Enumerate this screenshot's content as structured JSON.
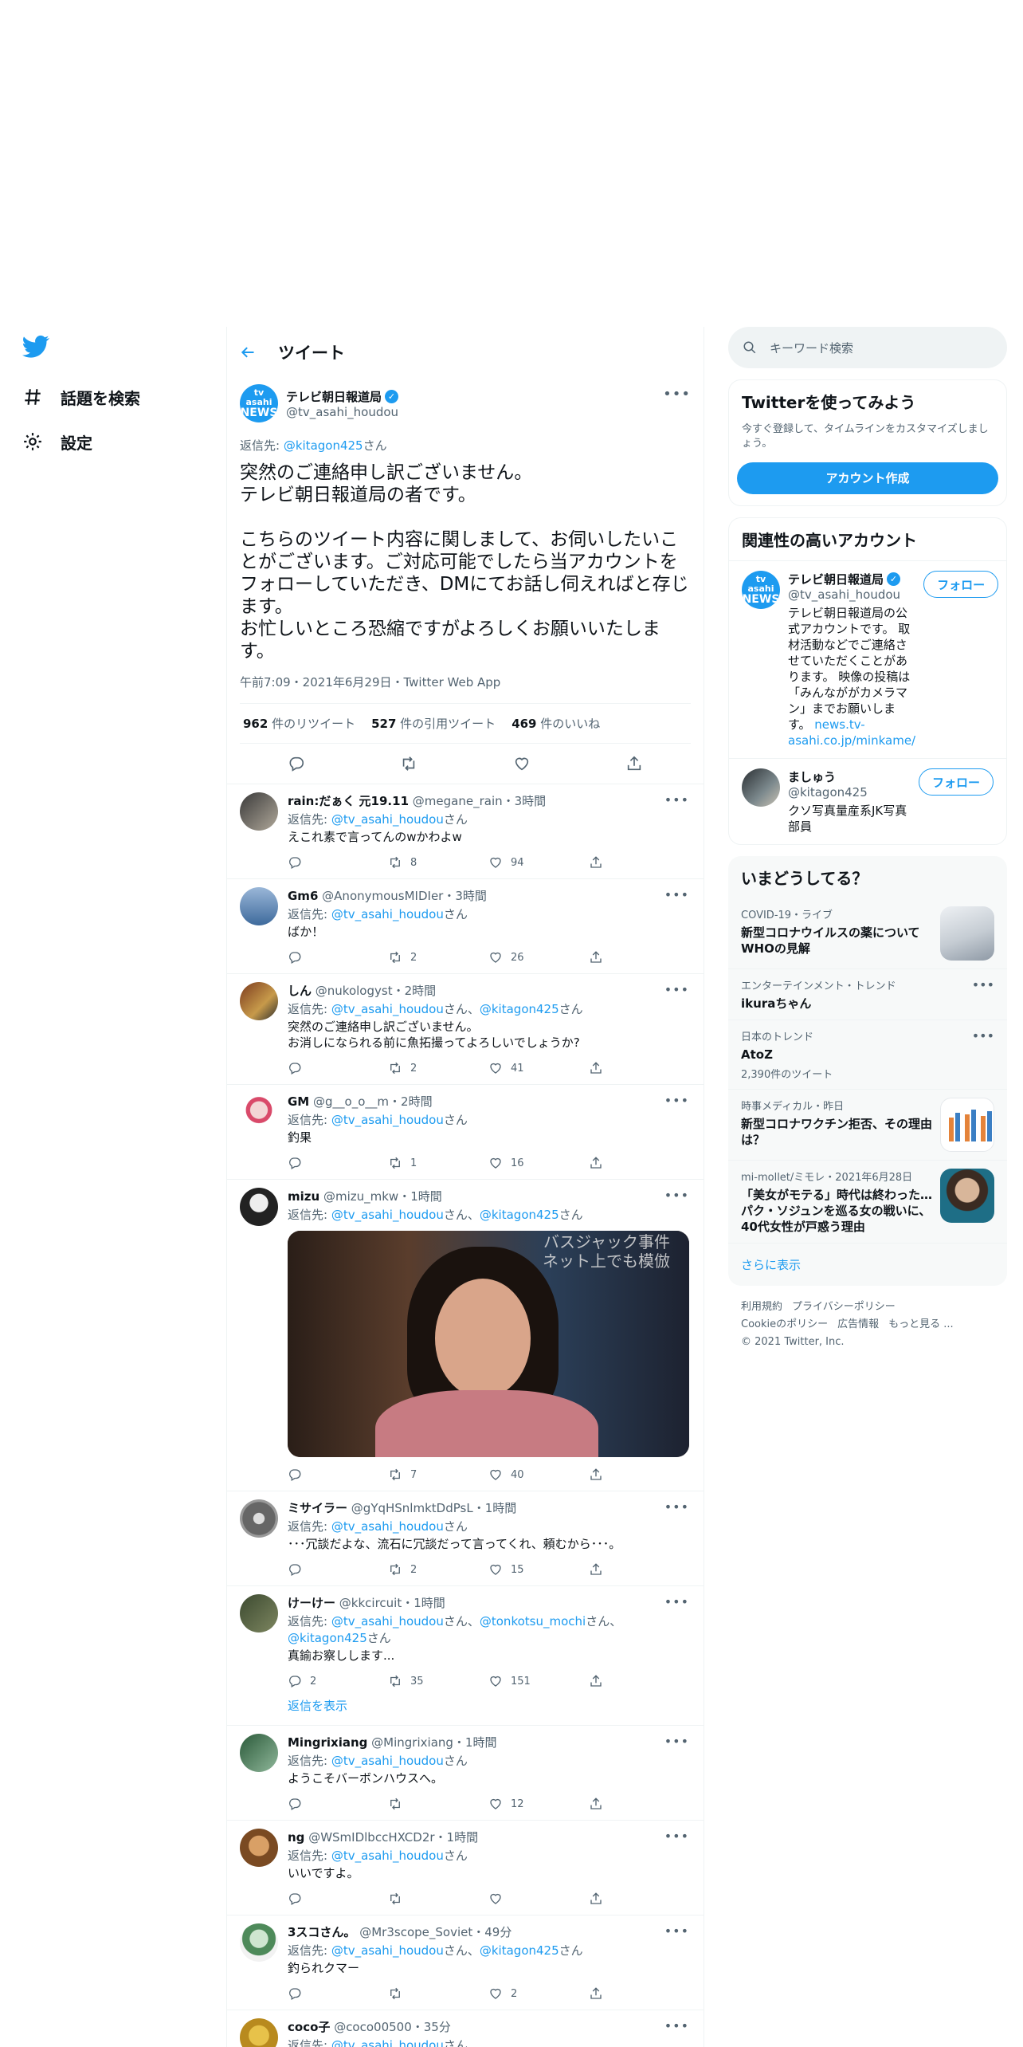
{
  "nav": {
    "items": [
      {
        "label": "話題を検索",
        "icon": "hashtag-icon"
      },
      {
        "label": "設定",
        "icon": "gear-icon"
      }
    ]
  },
  "header": {
    "title": "ツイート"
  },
  "main_tweet": {
    "name": "テレビ朝日報道局",
    "handle": "@tv_asahi_houdou",
    "avatar_text_1": "tv asahi",
    "avatar_text_2": "NEWS",
    "reply_prefix": "返信先: ",
    "reply_to": "@kitagon425",
    "reply_suffix": "さん",
    "text": "突然のご連絡申し訳ございません。\nテレビ朝日報道局の者です。\n\nこちらのツイート内容に関しまして、お伺いしたいことがございます。ご対応可能でしたら当アカウントをフォローしていただき、DMにてお話し伺えればと存じます。\nお忙しいところ恐縮ですがよろしくお願いいたします。",
    "meta": "午前7:09・2021年6月29日・Twitter Web App",
    "retweets": "962",
    "retweets_label": " 件のリツイート",
    "quotes": "527",
    "quotes_label": " 件の引用ツイート",
    "likes": "469",
    "likes_label": " 件のいいね"
  },
  "replies": [
    {
      "name": "rain:だぁく 元19.11",
      "handle": "@megane_rain",
      "time": "・3時間",
      "reply_to": "@tv_asahi_houdou",
      "reply_suffix": "さん",
      "text": "えこれ素で言ってんのwかわよw",
      "replies_count": "",
      "retweets_count": "8",
      "likes_count": "94"
    },
    {
      "name": "Gm6",
      "handle": "@AnonymousMIDIer",
      "time": "・3時間",
      "reply_to": "@tv_asahi_houdou",
      "reply_suffix": "さん",
      "text": "ばか！",
      "replies_count": "",
      "retweets_count": "2",
      "likes_count": "26"
    },
    {
      "name": "しん",
      "handle": "@nukologyst",
      "time": "・2時間",
      "reply_to": "@tv_asahi_houdou",
      "reply_mid": "さん、",
      "reply_to_2": "@kitagon425",
      "reply_suffix": "さん",
      "text": "突然のご連絡申し訳ございません。\nお消しになられる前に魚拓撮ってよろしいでしょうか?",
      "replies_count": "",
      "retweets_count": "2",
      "likes_count": "41"
    },
    {
      "name": "GM",
      "handle": "@g__o_o__m",
      "time": "・2時間",
      "reply_to": "@tv_asahi_houdou",
      "reply_suffix": "さん",
      "text": "釣果",
      "replies_count": "",
      "retweets_count": "1",
      "likes_count": "16"
    },
    {
      "name": "mizu",
      "handle": "@mizu_mkw",
      "time": "・1時間",
      "reply_to": "@tv_asahi_houdou",
      "reply_mid": "さん、",
      "reply_to_2": "@kitagon425",
      "reply_suffix": "さん",
      "text": "",
      "media_caption_1": "バスジャック事件",
      "media_caption_2": "ネット上でも模倣",
      "replies_count": "",
      "retweets_count": "7",
      "likes_count": "40"
    },
    {
      "name": "ミサイラー",
      "handle": "@gYqHSnlmktDdPsL",
      "time": "・1時間",
      "reply_to": "@tv_asahi_houdou",
      "reply_suffix": "さん",
      "text": "･･･冗談だよな、流石に冗談だって言ってくれ、頼むから･･･。",
      "replies_count": "",
      "retweets_count": "2",
      "likes_count": "15"
    },
    {
      "name": "けーけー",
      "handle": "@kkcircuit",
      "time": "・1時間",
      "reply_to": "@tv_asahi_houdou",
      "reply_mid": "さん、",
      "reply_to_2": "@tonkotsu_mochi",
      "reply_mid_2": "さん、",
      "reply_to_3": "@kitagon425",
      "reply_suffix": "さん",
      "text": "真鍮お察しします...",
      "replies_count": "2",
      "retweets_count": "35",
      "likes_count": "151",
      "show_replies": "返信を表示"
    },
    {
      "name": "Mingrixiang",
      "handle": "@Mingrixiang",
      "time": "・1時間",
      "reply_to": "@tv_asahi_houdou",
      "reply_suffix": "さん",
      "text": "ようこそバーボンハウスへ。",
      "replies_count": "",
      "retweets_count": "",
      "likes_count": "12"
    },
    {
      "name": "ng",
      "handle": "@WSmIDlbccHXCD2r",
      "time": "・1時間",
      "reply_to": "@tv_asahi_houdou",
      "reply_suffix": "さん",
      "text": "いいですよ。",
      "replies_count": "",
      "retweets_count": "",
      "likes_count": ""
    },
    {
      "name": "3スコさん。",
      "handle": "@Mr3scope_Soviet",
      "time": "・49分",
      "reply_to": "@tv_asahi_houdou",
      "reply_mid": "さん、",
      "reply_to_2": "@kitagon425",
      "reply_suffix": "さん",
      "text": "釣られクマー",
      "replies_count": "",
      "retweets_count": "",
      "likes_count": "2"
    },
    {
      "name": "coco子",
      "handle": "@coco00500",
      "time": "・35分",
      "reply_to": "@tv_asahi_houdou",
      "reply_suffix": "さん",
      "text": "",
      "replies_count": "",
      "retweets_count": "",
      "likes_count": ""
    }
  ],
  "search": {
    "placeholder": "キーワード検索"
  },
  "signup": {
    "title": "Twitterを使ってみよう",
    "sub": "今すぐ登録して、タイムラインをカスタマイズしましょう。",
    "button": "アカウント作成"
  },
  "related": {
    "title": "関連性の高いアカウント",
    "follow_label": "フォロー",
    "accounts": [
      {
        "name": "テレビ朝日報道局",
        "handle": "@tv_asahi_houdou",
        "bio": "テレビ朝日報道局の公式アカウントです。 取材活動などでご連絡させていただくことがあります。 映像の投稿は「みんなががカメラマン」までお願いします。 ",
        "bio_link": "news.tv-asahi.co.jp/minkame/"
      },
      {
        "name": "ましゅう",
        "handle": "@kitagon425",
        "bio": "クソ写真量産系JK写真部員",
        "bio_link": ""
      }
    ]
  },
  "trends": {
    "title": "いまどうしてる？",
    "items": [
      {
        "category": "COVID-19・ライブ",
        "title": "新型コロナウイルスの薬について WHOの見解",
        "count": ""
      },
      {
        "category": "エンターテインメント・トレンド",
        "title": "ikuraちゃん",
        "count": ""
      },
      {
        "category": "日本のトレンド",
        "title": "AtoZ",
        "count": "2,390件のツイート"
      },
      {
        "category": "時事メディカル・昨日",
        "title": "新型コロナワクチン拒否、その理由は？",
        "count": ""
      },
      {
        "category": "mi-mollet/ミモレ・2021年6月28日",
        "title": "「美女がモテる」時代は終わった…パク・ソジュンを巡る女の戦いに、40代女性が戸惑う理由",
        "count": ""
      }
    ],
    "show_more": "さらに表示"
  },
  "footer": {
    "links": [
      "利用規約",
      "プライバシーポリシー",
      "Cookieのポリシー",
      "広告情報",
      "もっと見る ..."
    ],
    "copyright": "© 2021 Twitter, Inc."
  },
  "colors": {
    "accent": "#1d9bf0",
    "text": "#0f1419",
    "muted": "#536471"
  }
}
